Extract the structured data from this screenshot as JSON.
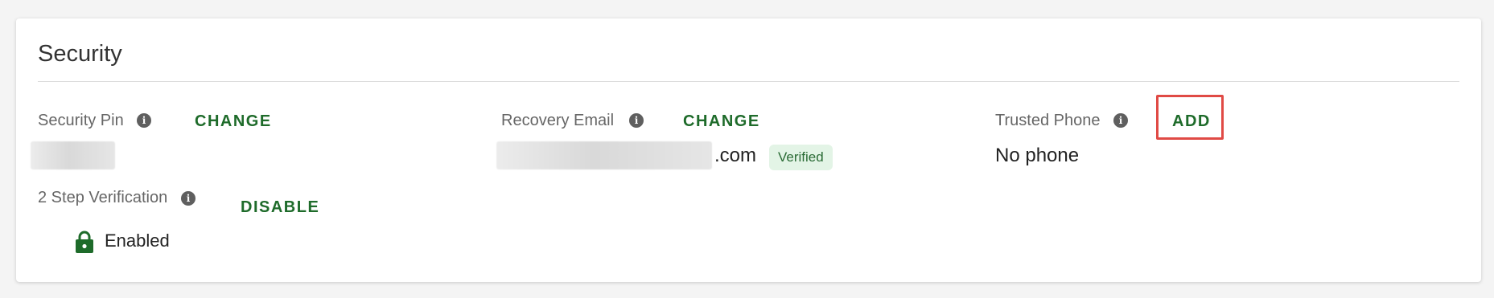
{
  "section": {
    "title": "Security"
  },
  "security_pin": {
    "label": "Security Pin",
    "action": "CHANGE"
  },
  "recovery_email": {
    "label": "Recovery Email",
    "action": "CHANGE",
    "value_suffix": ".com",
    "badge": "Verified"
  },
  "trusted_phone": {
    "label": "Trusted Phone",
    "action": "ADD",
    "value": "No phone"
  },
  "two_step": {
    "label": "2 Step Verification",
    "action": "DISABLE",
    "status": "Enabled"
  },
  "icons": {
    "info": "info-icon",
    "lock": "lock-icon"
  },
  "colors": {
    "accent": "#1e6b2a",
    "highlight": "#e04a45",
    "badge_bg": "#e3f4e6"
  }
}
